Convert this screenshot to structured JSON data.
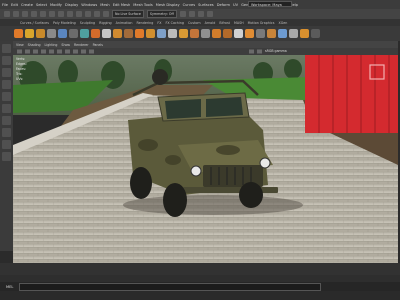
{
  "menu": [
    "File",
    "Edit",
    "Create",
    "Select",
    "Modify",
    "Display",
    "Windows",
    "Mesh",
    "Edit Mesh",
    "Mesh Tools",
    "Mesh Display",
    "Curves",
    "Surfaces",
    "Deform",
    "UV",
    "Generate",
    "Cache",
    "Arnold",
    "Help"
  ],
  "status": {
    "workspace": "Workspace: Maya Classic",
    "no_live_surface": "No Live Surface",
    "symmetry": "Symmetry: Off"
  },
  "shelf_tabs": [
    "Curves / Surfaces",
    "Poly Modeling",
    "Sculpting",
    "Rigging",
    "Animation",
    "Rendering",
    "FX",
    "FX Caching",
    "Custom",
    "Arnold",
    "Bifrost",
    "MASH",
    "Motion Graphics",
    "XGen"
  ],
  "viewport_menu": [
    "View",
    "Shading",
    "Lighting",
    "Show",
    "Renderer",
    "Panels"
  ],
  "viewport_panel": {
    "gamma": "sRGB gamma"
  },
  "hud": {
    "rows": [
      {
        "label": "Verts:",
        "value": ""
      },
      {
        "label": "Edges:",
        "value": ""
      },
      {
        "label": "Faces:",
        "value": ""
      },
      {
        "label": "Tris:",
        "value": ""
      },
      {
        "label": "UVs:",
        "value": ""
      }
    ]
  },
  "cmdline": {
    "label": "MEL"
  },
  "colors": {
    "sky": "#5c6b5a",
    "grass": "#3f7a2e",
    "pavement": "#b8b3a7",
    "container": "#d42a2f",
    "vehicle": "#5b5a3a"
  }
}
